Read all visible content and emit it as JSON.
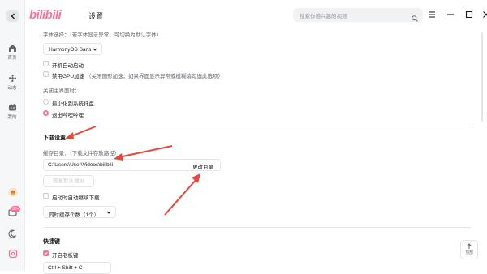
{
  "app": {
    "logo_text": "bilibili",
    "window_title": "设置"
  },
  "search": {
    "placeholder": "搜索你感兴趣的视频"
  },
  "sidebar": {
    "items": [
      {
        "label": "首页",
        "icon": "home-icon"
      },
      {
        "label": "动态",
        "icon": "fan-icon"
      },
      {
        "label": "我的",
        "icon": "tv-icon"
      }
    ],
    "badge": "99+"
  },
  "font": {
    "label": "字体选择：（若字体显示异常，可切换为默认字体）",
    "selected": "HarmonyOS Sans"
  },
  "options": {
    "autostart": "开机自动启动",
    "disable_gpu": "禁用GPU加速",
    "disable_gpu_note": "（关闭图形加速，如果界面显示异常或模糊请勾选此选项）"
  },
  "close_main": {
    "label": "关闭主界面时：",
    "minimize": "最小化到系统托盘",
    "exit": "退出哔哩哔哩"
  },
  "download": {
    "title": "下载设置",
    "cache_label": "缓存目录：（下载文件存放路径）",
    "path": "C:\\Users\\User\\Videos\\bilibili",
    "change_dir": "更改目录",
    "restore_default": "恢复默认地址",
    "auto_resume": "启动时自动继续下载",
    "concurrent": "同时缓存个数（1个）"
  },
  "shortcut": {
    "title": "快捷键",
    "boss_key": "开启老板键",
    "boss_combo": "Ctrl + Shift + C"
  },
  "back_to_top": "顶部",
  "colors": {
    "accent": "#fb7299",
    "annotation": "#e8473d"
  }
}
